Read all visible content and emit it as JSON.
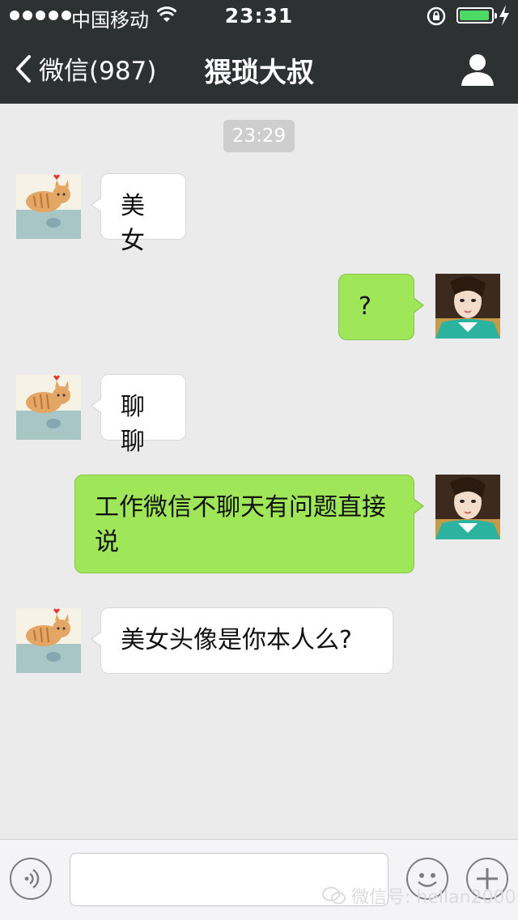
{
  "status_bar": {
    "carrier": "中国移动",
    "time": "23:31"
  },
  "nav": {
    "back_label": "微信(987)",
    "title": "猥琐大叔"
  },
  "chat": {
    "timestamp": "23:29",
    "messages": [
      {
        "from": "contact",
        "avatar": "cat-avatar",
        "text": "美女"
      },
      {
        "from": "me",
        "avatar": "girl-avatar",
        "text": "?"
      },
      {
        "from": "contact",
        "avatar": "cat-avatar",
        "text": "聊聊"
      },
      {
        "from": "me",
        "avatar": "girl-avatar",
        "text": "工作微信不聊天有问题直接说"
      },
      {
        "from": "contact",
        "avatar": "cat-avatar",
        "text": "美女头像是你本人么?"
      }
    ]
  },
  "input_bar": {
    "text_value": "",
    "voice_icon": "voice-icon",
    "emoji_icon": "emoji-icon",
    "plus_icon": "plus-icon"
  },
  "watermark": {
    "text": "微信号: hellan2000"
  },
  "colors": {
    "header_bg": "#2e3132",
    "chat_bg": "#ebebeb",
    "sent_bubble": "#9fe658",
    "received_bubble": "#ffffff",
    "battery": "#4cd964"
  }
}
